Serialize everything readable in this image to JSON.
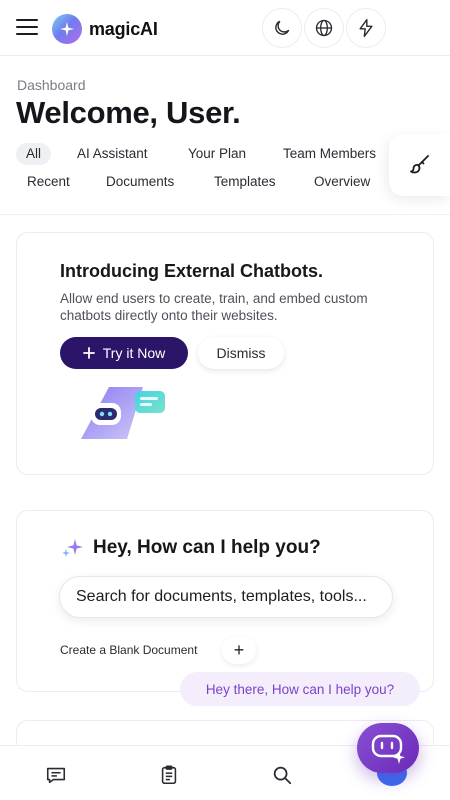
{
  "header": {
    "app_name": "magicAI",
    "icons": [
      "menu-icon",
      "magic-logo-icon",
      "moon-icon",
      "globe-icon",
      "lightning-icon"
    ]
  },
  "page": {
    "breadcrumb": "Dashboard",
    "title": "Welcome, User."
  },
  "filters": [
    "All",
    "AI Assistant",
    "Your Plan",
    "Team Members",
    "Recent",
    "Documents",
    "Templates",
    "Overview"
  ],
  "promo": {
    "title": "Introducing External Chatbots.",
    "text": "Allow end users to create, train, and embed custom chatbots directly onto their websites.",
    "try_label": "Try it Now",
    "dismiss_label": "Dismiss"
  },
  "assistant": {
    "title": "Hey, How can I help you?",
    "search_placeholder": "Search for documents, templates, tools...",
    "blank_label": "Create a Blank Document",
    "plus": "+"
  },
  "chat": {
    "bubble": "Hey there, How can I help you?"
  },
  "colors": {
    "primary": "#2b1568",
    "accent_purple": "#7a42c8",
    "bubble_bg": "#f4eefc",
    "fab": "#6a2bb8"
  },
  "bottom_nav": [
    "chat-icon",
    "clipboard-icon",
    "search-icon"
  ]
}
